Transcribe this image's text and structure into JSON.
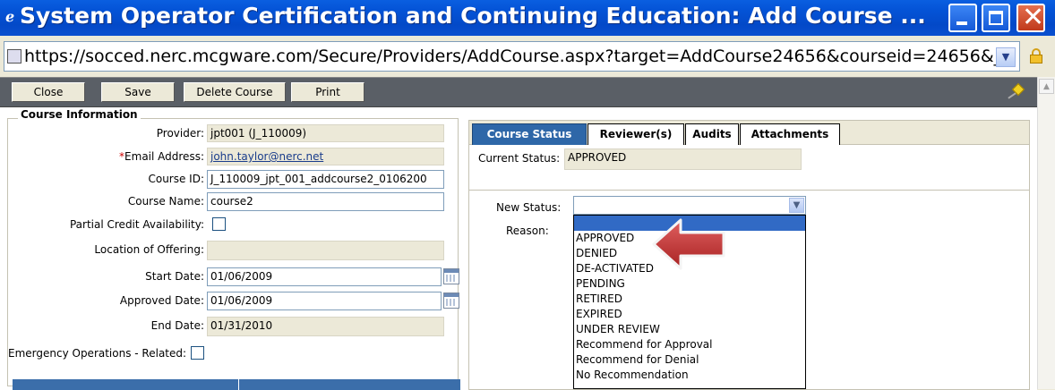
{
  "window": {
    "title": "System Operator Certification and Continuing Education: Add Course ...",
    "url": "https://socced.nerc.mcgware.com/Secure/Providers/AddCourse.aspx?target=AddCourse24656&courseid=24656&_F"
  },
  "toolbar": {
    "buttons": [
      "Close",
      "Save",
      "Delete Course",
      "Print"
    ]
  },
  "course_info": {
    "legend": "Course Information",
    "provider_label": "Provider:",
    "provider_value": "jpt001 (J_110009)",
    "email_required_mark": "*",
    "email_label": "Email Address:",
    "email_value": "john.taylor@nerc.net",
    "course_id_label": "Course ID:",
    "course_id_value": "J_110009_jpt_001_addcourse2_0106200",
    "course_name_label": "Course Name:",
    "course_name_value": "course2",
    "partial_credit_label": "Partial Credit Availability:",
    "location_label": "Location of Offering:",
    "location_value": "",
    "start_date_label": "Start Date:",
    "start_date_value": "01/06/2009",
    "approved_date_label": "Approved Date:",
    "approved_date_value": "01/06/2009",
    "end_date_label": "End Date:",
    "end_date_value": "01/31/2010",
    "emergency_label": "Emergency Operations - Related:"
  },
  "tabs": [
    "Course Status",
    "Reviewer(s)",
    "Audits",
    "Attachments"
  ],
  "status": {
    "current_label": "Current Status:",
    "current_value": "APPROVED",
    "new_status_label": "New Status:",
    "new_status_value": "",
    "reason_label": "Reason:",
    "options": [
      "",
      "APPROVED",
      "DENIED",
      "DE-ACTIVATED",
      "PENDING",
      "RETIRED",
      "EXPIRED",
      "UNDER REVIEW",
      "Recommend for Approval",
      "Recommend for Denial",
      "No Recommendation"
    ]
  },
  "colors": {
    "titlebar": "#0453d6",
    "active_tab": "#2e67a8",
    "highlight": "#316ac5",
    "annotation_arrow": "#c0392b"
  }
}
